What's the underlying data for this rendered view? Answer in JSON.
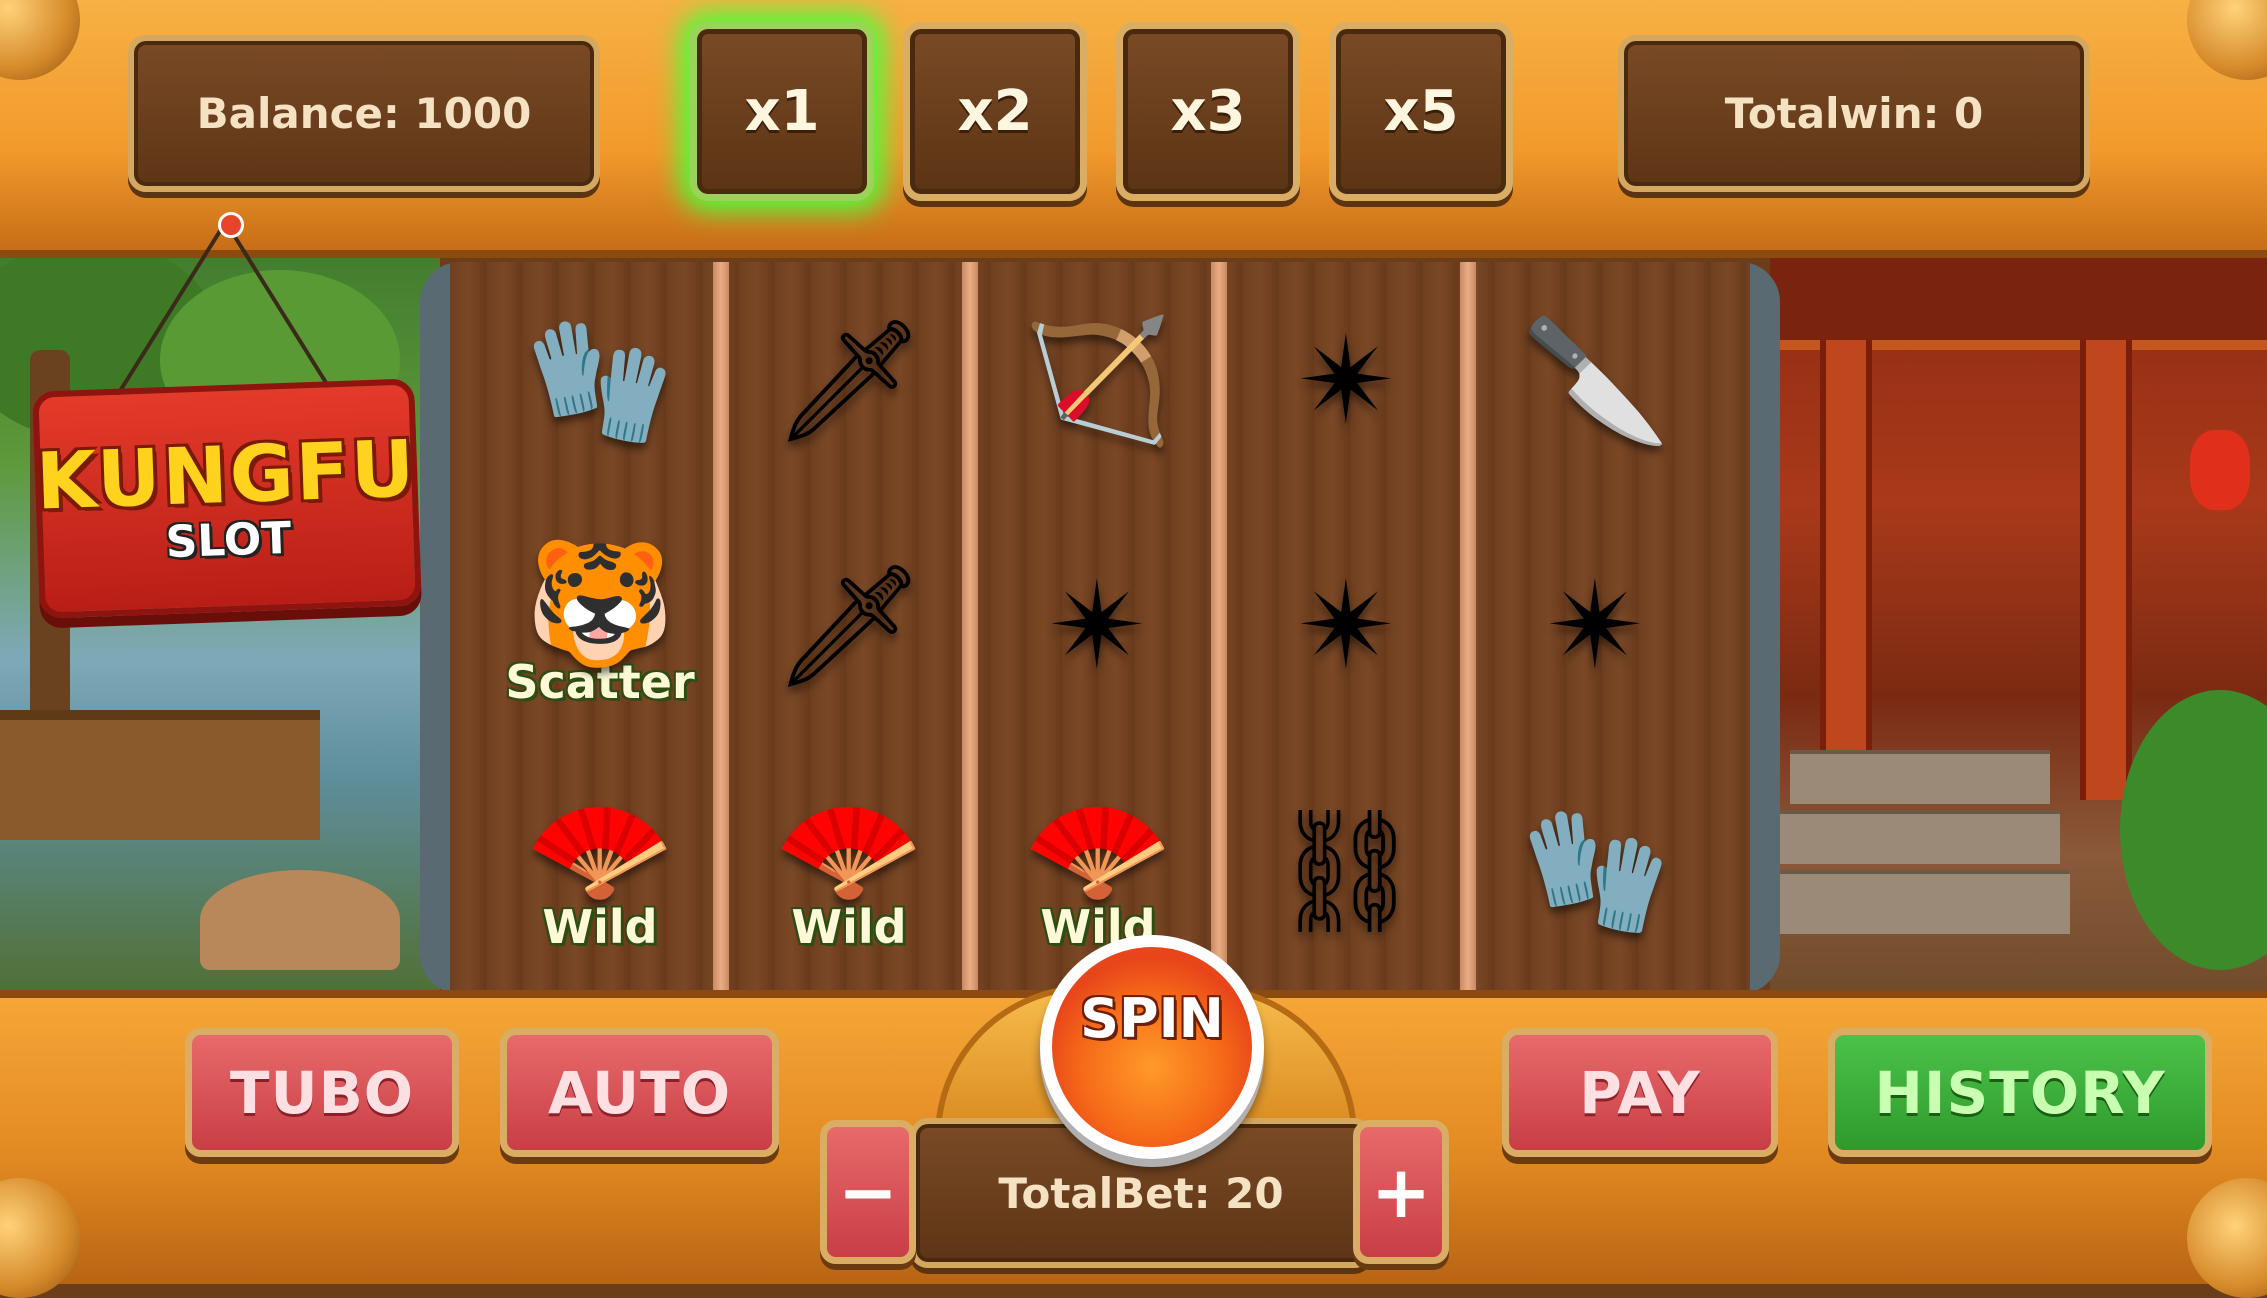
{
  "header": {
    "balance_text": "Balance: 1000",
    "totalwin_text": "Totalwin: 0",
    "multipliers": [
      "x1",
      "x2",
      "x3",
      "x5"
    ],
    "active_multiplier": "x1"
  },
  "logo": {
    "title": "KUNGFU",
    "subtitle": "SLOT"
  },
  "reels": {
    "columns": [
      [
        {
          "icon": "glove-icon",
          "glyph": "🧤",
          "label": ""
        },
        {
          "icon": "tiger-scatter-icon",
          "glyph": "🐯",
          "label": "Scatter"
        },
        {
          "icon": "fan-wild-icon",
          "glyph": "🪭",
          "label": "Wild"
        }
      ],
      [
        {
          "icon": "kunai-icon",
          "glyph": "🗡",
          "label": ""
        },
        {
          "icon": "kunai-icon",
          "glyph": "🗡",
          "label": ""
        },
        {
          "icon": "fan-wild-icon",
          "glyph": "🪭",
          "label": "Wild"
        }
      ],
      [
        {
          "icon": "bo-staff-icon",
          "glyph": "🏹",
          "label": ""
        },
        {
          "icon": "shuriken-icon",
          "glyph": "✴",
          "label": ""
        },
        {
          "icon": "fan-wild-icon",
          "glyph": "🪭",
          "label": "Wild"
        }
      ],
      [
        {
          "icon": "shuriken-icon",
          "glyph": "✴",
          "label": ""
        },
        {
          "icon": "shuriken-icon",
          "glyph": "✴",
          "label": ""
        },
        {
          "icon": "nunchaku-icon",
          "glyph": "⛓",
          "label": ""
        }
      ],
      [
        {
          "icon": "wrist-blade-icon",
          "glyph": "🔪",
          "label": ""
        },
        {
          "icon": "shuriken-icon",
          "glyph": "✴",
          "label": ""
        },
        {
          "icon": "glove-icon",
          "glyph": "🧤",
          "label": ""
        }
      ]
    ]
  },
  "controls": {
    "tubo_label": "TUBO",
    "auto_label": "AUTO",
    "spin_label": "SPIN",
    "pay_label": "PAY",
    "history_label": "HISTORY",
    "minus_label": "−",
    "plus_label": "+",
    "totalbet_text": "TotalBet: 20"
  },
  "colors": {
    "frame_orange": "#f29a2c",
    "panel_brown": "#5d3515",
    "active_glow": "#4cff3a",
    "button_red": "#c83e46",
    "button_green": "#2e9a2c"
  }
}
